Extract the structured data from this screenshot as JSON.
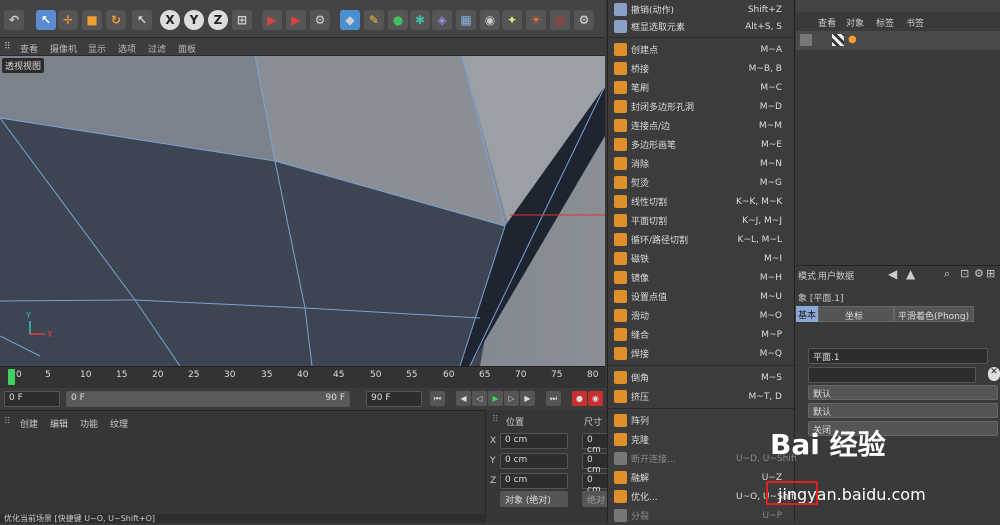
{
  "toolbar": {
    "axis_buttons": [
      "X",
      "Y",
      "Z"
    ]
  },
  "viewport_menu": {
    "items": [
      "查看",
      "摄像机",
      "显示",
      "选项",
      "过滤",
      "面板"
    ],
    "view_label": "透视视图"
  },
  "timeline": {
    "ticks": [
      "0",
      "5",
      "10",
      "15",
      "20",
      "25",
      "30",
      "35",
      "40",
      "45",
      "50",
      "55",
      "60",
      "65",
      "70",
      "75",
      "80"
    ],
    "start_field": "0 F",
    "slider_start": "0 F",
    "slider_end": "90 F",
    "end_field": "90 F"
  },
  "material_menu": {
    "items": [
      "创建",
      "编辑",
      "功能",
      "纹理"
    ],
    "status": "优化当前场景 [快捷键 U~O, U~Shift+O]"
  },
  "coordinates": {
    "position_header": "位置",
    "size_header": "尺寸",
    "rows": [
      {
        "axis": "X",
        "value": "0 cm",
        "size": "0 cm"
      },
      {
        "axis": "Y",
        "value": "0 cm",
        "size": "0 cm"
      },
      {
        "axis": "Z",
        "value": "0 cm",
        "size": "0 cm"
      }
    ],
    "mode": "对象 (绝对)",
    "apply": "绝对"
  },
  "context_menu": {
    "items": [
      {
        "label": "撤销(动作)",
        "shortcut": "Shift+Z",
        "icon_color": "#8aa0c8",
        "disabled": false
      },
      {
        "label": "框显选取元素",
        "shortcut": "Alt+S, S",
        "icon_color": "#8aa0c8",
        "disabled": false
      },
      {
        "label": "创建点",
        "shortcut": "M~A",
        "icon_color": "#e0902a",
        "disabled": false
      },
      {
        "label": "桥接",
        "shortcut": "M~B, B",
        "icon_color": "#e0902a",
        "disabled": false
      },
      {
        "label": "笔刷",
        "shortcut": "M~C",
        "icon_color": "#e0902a",
        "disabled": false
      },
      {
        "label": "封闭多边形孔洞",
        "shortcut": "M~D",
        "icon_color": "#e0902a",
        "disabled": false
      },
      {
        "label": "连接点/边",
        "shortcut": "M~M",
        "icon_color": "#e0902a",
        "disabled": false
      },
      {
        "label": "多边形画笔",
        "shortcut": "M~E",
        "icon_color": "#e0902a",
        "disabled": false
      },
      {
        "label": "消除",
        "shortcut": "M~N",
        "icon_color": "#e0902a",
        "disabled": false
      },
      {
        "label": "熨烫",
        "shortcut": "M~G",
        "icon_color": "#e0902a",
        "disabled": false
      },
      {
        "label": "线性切割",
        "shortcut": "K~K, M~K",
        "icon_color": "#e0902a",
        "disabled": false
      },
      {
        "label": "平面切割",
        "shortcut": "K~J, M~J",
        "icon_color": "#e0902a",
        "disabled": false
      },
      {
        "label": "循环/路径切割",
        "shortcut": "K~L, M~L",
        "icon_color": "#e0902a",
        "disabled": false
      },
      {
        "label": "磁铁",
        "shortcut": "M~I",
        "icon_color": "#e0902a",
        "disabled": false
      },
      {
        "label": "镜像",
        "shortcut": "M~H",
        "icon_color": "#e0902a",
        "disabled": false
      },
      {
        "label": "设置点值",
        "shortcut": "M~U",
        "icon_color": "#e0902a",
        "disabled": false
      },
      {
        "label": "滑动",
        "shortcut": "M~O",
        "icon_color": "#e0902a",
        "disabled": false
      },
      {
        "label": "缝合",
        "shortcut": "M~P",
        "icon_color": "#e0902a",
        "disabled": false
      },
      {
        "label": "焊接",
        "shortcut": "M~Q",
        "icon_color": "#e0902a",
        "disabled": false
      },
      {
        "label": "倒角",
        "shortcut": "M~S",
        "icon_color": "#e0902a",
        "disabled": false
      },
      {
        "label": "挤压",
        "shortcut": "M~T, D",
        "icon_color": "#e0902a",
        "disabled": false
      },
      {
        "label": "阵列",
        "shortcut": "",
        "icon_color": "#e0902a",
        "disabled": false
      },
      {
        "label": "克隆",
        "shortcut": "",
        "icon_color": "#e0902a",
        "disabled": false
      },
      {
        "label": "断开连接...",
        "shortcut": "U~D, U~Shift",
        "icon_color": "#777777",
        "disabled": true
      },
      {
        "label": "融解",
        "shortcut": "U~Z",
        "icon_color": "#e0902a",
        "disabled": false
      },
      {
        "label": "优化...",
        "shortcut": "U~O, U~Shift",
        "icon_color": "#e0902a",
        "disabled": false
      },
      {
        "label": "分裂",
        "shortcut": "U~P",
        "icon_color": "#777777",
        "disabled": true
      }
    ]
  },
  "object_panel": {
    "menu": [
      "查看",
      "对象",
      "标签",
      "书签"
    ]
  },
  "attr_panel": {
    "menu": [
      "模式",
      "用户数据"
    ],
    "object_title": "象 [平面.1]",
    "tabs": [
      "基本",
      "坐标",
      "平滑着色(Phong)"
    ],
    "name_value": "平面.1",
    "dropdowns": [
      "默认",
      "默认",
      "关闭"
    ]
  },
  "watermark": {
    "text": "jingyan.baidu.com",
    "logo_text": "Bai 经验"
  }
}
